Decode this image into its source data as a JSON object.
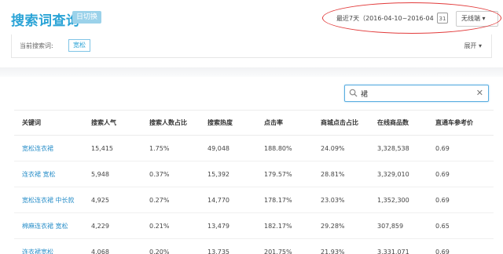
{
  "header": {
    "title": "搜索词查询",
    "daily_tag": "日切换",
    "date_range": "最近7天（2016-04-10~2016-04-16）",
    "calendar_icon_text": "31",
    "device_select": "无线端 ▾"
  },
  "filter": {
    "current_label": "当前搜索词:",
    "current_value": "宽松",
    "expand_label": "展开 ▾"
  },
  "search": {
    "value": "裙",
    "clear": "✕"
  },
  "table": {
    "columns": [
      "关键词",
      "搜索人气",
      "搜索人数占比",
      "搜索热度",
      "点击率",
      "商城点击占比",
      "在线商品数",
      "直通车参考价"
    ],
    "rows": [
      [
        "宽松连衣裙",
        "15,415",
        "1.75%",
        "49,048",
        "188.80%",
        "24.09%",
        "3,328,538",
        "0.69"
      ],
      [
        "连衣裙 宽松",
        "5,948",
        "0.37%",
        "15,392",
        "179.57%",
        "28.81%",
        "3,329,010",
        "0.69"
      ],
      [
        "宽松连衣裙 中长款",
        "4,925",
        "0.27%",
        "14,770",
        "178.17%",
        "23.03%",
        "1,352,300",
        "0.69"
      ],
      [
        "棉麻连衣裙 宽松",
        "4,229",
        "0.21%",
        "13,479",
        "182.17%",
        "29.28%",
        "307,859",
        "0.65"
      ],
      [
        "连衣裙宽松",
        "4,068",
        "0.20%",
        "13,735",
        "201.75%",
        "21.93%",
        "3,331,071",
        "0.69"
      ]
    ]
  },
  "colors": {
    "accent": "#2aa3d6",
    "highlight_circle": "#e23b3b"
  }
}
